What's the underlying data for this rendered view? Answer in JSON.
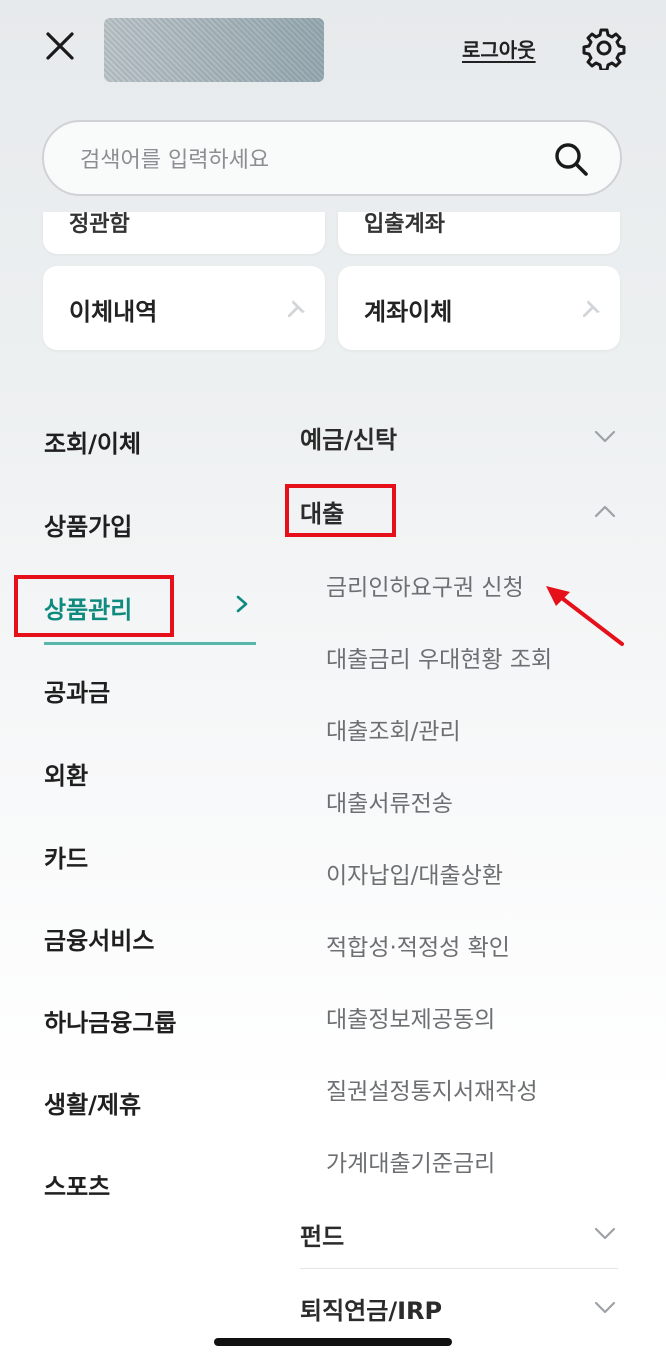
{
  "header": {
    "close_icon": "close-icon",
    "logout_label": "로그아웃",
    "settings_icon": "gear-icon"
  },
  "search": {
    "placeholder": "검색어를 입력하세요",
    "icon": "search-icon"
  },
  "quick_menu": {
    "partial_cards": [
      "정관함",
      "입출계좌"
    ],
    "cards": [
      {
        "label": "이체내역",
        "icon": "pin-icon"
      },
      {
        "label": "계좌이체",
        "icon": "pin-icon"
      }
    ]
  },
  "left_nav": {
    "items": [
      {
        "label": "조회/이체"
      },
      {
        "label": "상품가입"
      },
      {
        "label": "상품관리"
      },
      {
        "label": "공과금"
      },
      {
        "label": "외환"
      },
      {
        "label": "카드"
      },
      {
        "label": "금융서비스"
      },
      {
        "label": "하나금융그룹"
      },
      {
        "label": "생활/제휴"
      },
      {
        "label": "스포츠"
      }
    ],
    "active_index": 2
  },
  "right_menu": {
    "categories": [
      {
        "label": "예금/신탁",
        "expanded": false
      },
      {
        "label": "대출",
        "expanded": true
      },
      {
        "label": "펀드",
        "expanded": false
      },
      {
        "label": "퇴직연금/IRP",
        "expanded": false
      }
    ],
    "loan_items": [
      "금리인하요구권 신청",
      "대출금리 우대현황 조회",
      "대출조회/관리",
      "대출서류전송",
      "이자납입/대출상환",
      "적합성·적정성 확인",
      "대출정보제공동의",
      "질권설정통지서재작성",
      "가계대출기준금리"
    ]
  },
  "colors": {
    "accent": "#0f8a7e",
    "highlight_red": "#e5101a"
  }
}
